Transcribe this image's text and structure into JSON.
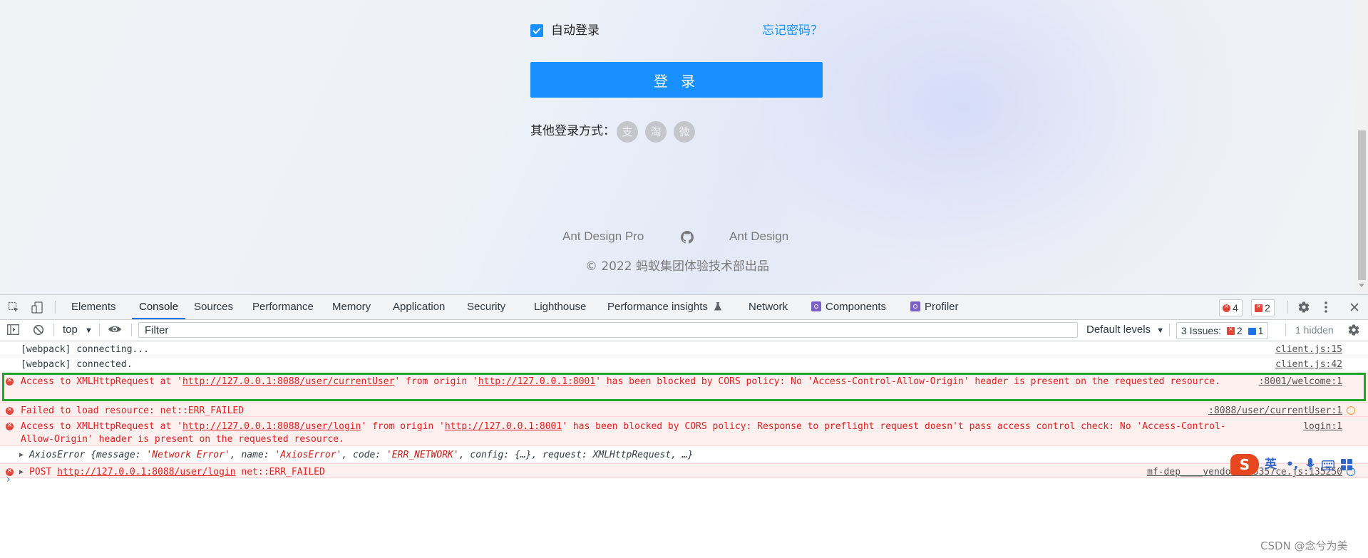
{
  "login": {
    "auto_login_label": "自动登录",
    "forgot_password": "忘记密码？",
    "login_button": "登 录",
    "other_methods_label": "其他登录方式：",
    "social_icons": [
      {
        "name": "alipay-icon",
        "glyph": "支"
      },
      {
        "name": "taobao-icon",
        "glyph": "淘"
      },
      {
        "name": "weibo-icon",
        "glyph": "微"
      }
    ],
    "footer_links": [
      "Ant Design Pro",
      "Ant Design"
    ],
    "copyright": "2022 蚂蚁集团体验技术部出品"
  },
  "devtools": {
    "tabs": [
      "Elements",
      "Console",
      "Sources",
      "Performance",
      "Memory",
      "Application",
      "Security",
      "Lighthouse",
      "Performance insights",
      "Network",
      "Components",
      "Profiler"
    ],
    "active_tab": "Console",
    "error_count": "4",
    "issue_badge_count": "2",
    "context": "top",
    "filter_placeholder": "Filter",
    "levels": "Default levels",
    "issues_label": "3 Issues:",
    "issues_errors": "2",
    "issues_info": "1",
    "hidden": "1 hidden",
    "messages": [
      {
        "type": "log",
        "text": "[webpack] connecting...",
        "source": "client.js:15"
      },
      {
        "type": "log",
        "text": "[webpack] connected.",
        "source": "client.js:42"
      },
      {
        "type": "error",
        "pre": "Access to XMLHttpRequest at '",
        "url1": "http://127.0.0.1:8088/user/currentUser",
        "mid": "' from origin '",
        "url2": "http://127.0.0.1:8001",
        "post": "' has been blocked by CORS policy: No 'Access-Control-Allow-Origin' header is present on the requested resource.",
        "source": ":8001/welcome:1"
      },
      {
        "type": "error",
        "text": "Failed to load resource: net::ERR_FAILED",
        "source": ":8088/user/currentUser:1"
      },
      {
        "type": "error",
        "pre": "Access to XMLHttpRequest at '",
        "url1": "http://127.0.0.1:8088/user/login",
        "mid": "' from origin '",
        "url2": "http://127.0.0.1:8001",
        "post": "' has been blocked by CORS policy: Response to preflight request doesn't pass access control check: No 'Access-Control-Allow-Origin' header is present on the requested resource.",
        "source": "login:1"
      },
      {
        "type": "log",
        "source": ""
      },
      {
        "type": "error",
        "method": "POST",
        "url": "http://127.0.0.1:8088/user/login",
        "suffix": "net::ERR_FAILED",
        "source": "mf-dep____vendor.423357ce.js:135250"
      }
    ],
    "axios": {
      "prefix": "AxiosError",
      "message_key": "message:",
      "message_val": "'Network Error'",
      "name_key": "name:",
      "name_val": "'AxiosError'",
      "code_key": "code:",
      "code_val": "'ERR_NETWORK'",
      "config": "config: {…}",
      "request": "request: XMLHttpRequest, …}"
    }
  },
  "ime": {
    "lang": "英",
    "punct": "•,"
  },
  "watermark": "CSDN @念兮为美",
  "colors": {
    "primary": "#1890ff",
    "error": "#e02020",
    "highlight": "#22a32a"
  }
}
